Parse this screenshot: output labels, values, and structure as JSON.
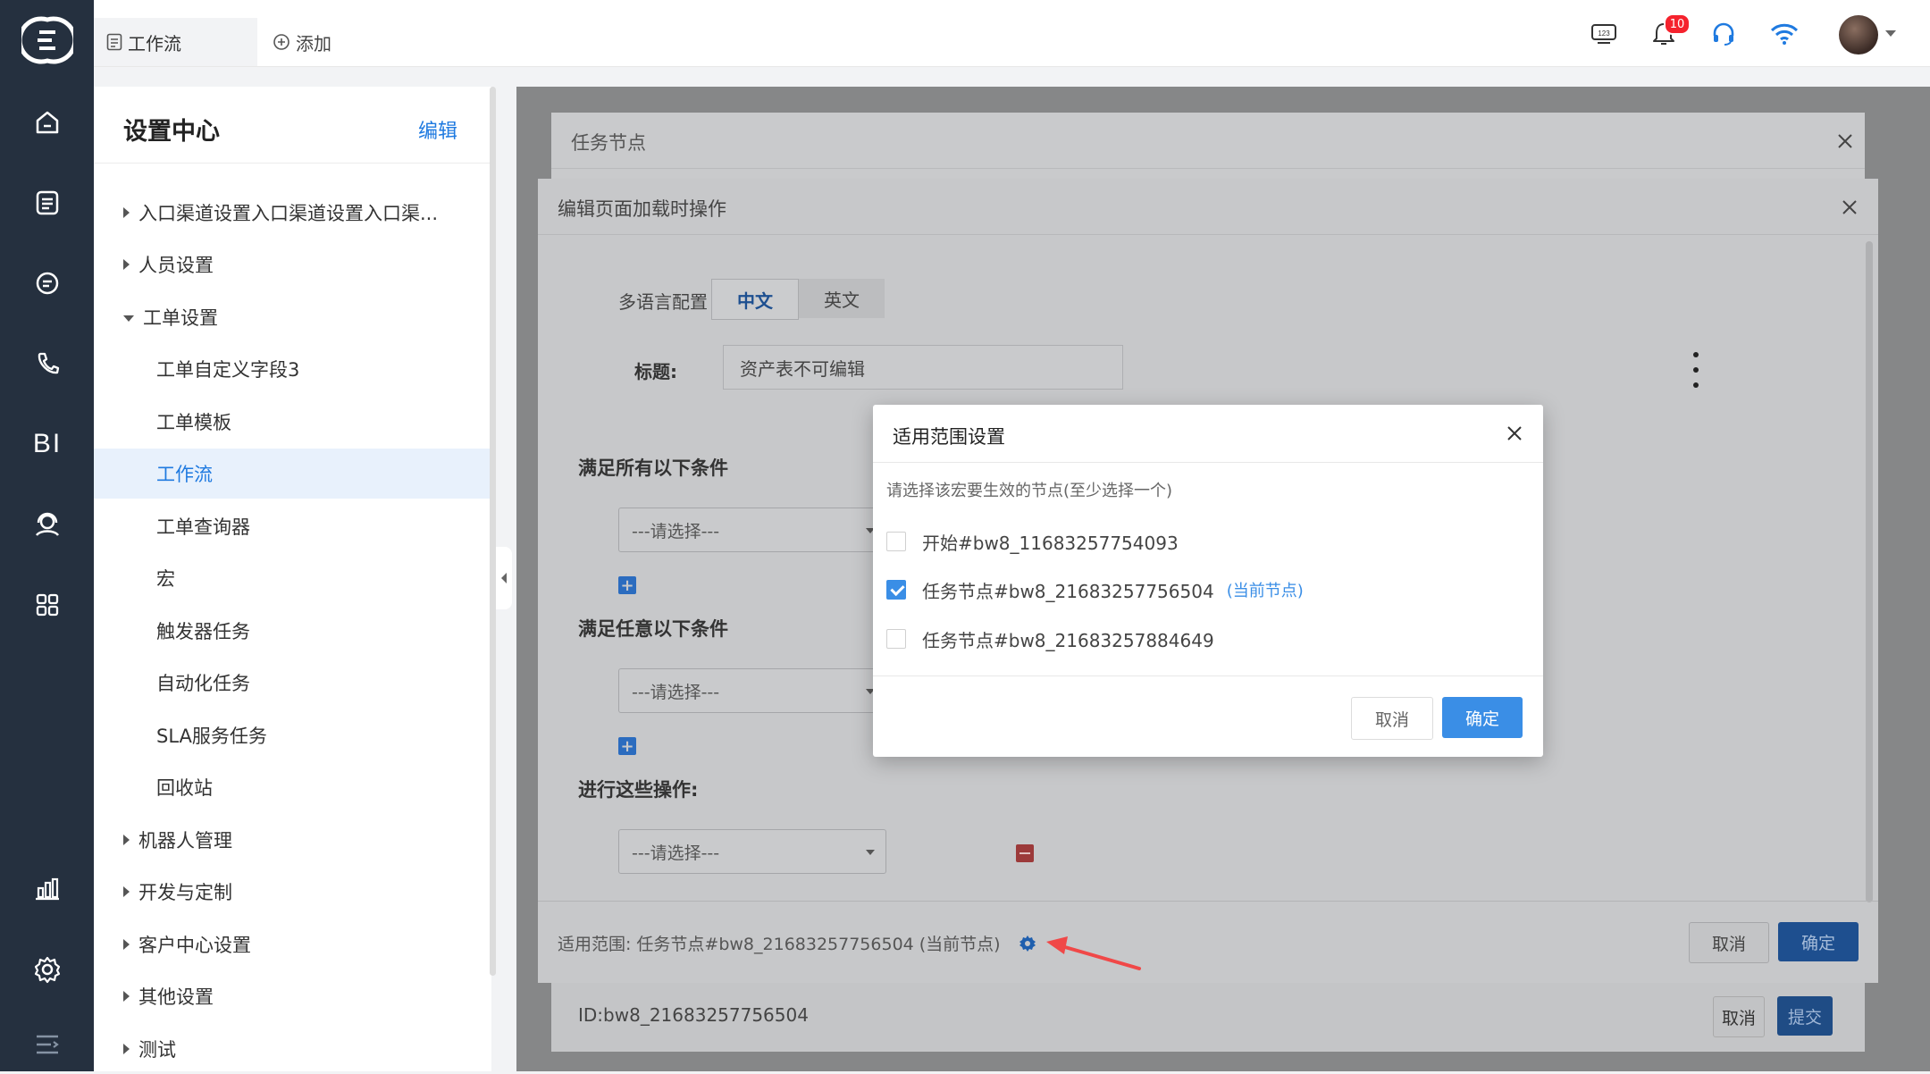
{
  "topbar": {
    "tab_label": "工作流",
    "add_label": "添加",
    "notification_count": "10"
  },
  "sidebar": {
    "title": "设置中心",
    "edit_label": "编辑",
    "items": [
      {
        "label": "入口渠道设置入口渠道设置入口渠..."
      },
      {
        "label": "人员设置"
      },
      {
        "label": "工单设置"
      },
      {
        "label": "工单自定义字段3"
      },
      {
        "label": "工单模板"
      },
      {
        "label": "工作流"
      },
      {
        "label": "工单查询器"
      },
      {
        "label": "宏"
      },
      {
        "label": "触发器任务"
      },
      {
        "label": "自动化任务"
      },
      {
        "label": "SLA服务任务"
      },
      {
        "label": "回收站"
      },
      {
        "label": "机器人管理"
      },
      {
        "label": "开发与定制"
      },
      {
        "label": "客户中心设置"
      },
      {
        "label": "其他设置"
      },
      {
        "label": "测试"
      }
    ]
  },
  "rail": {
    "bi_label": "BI"
  },
  "task_modal": {
    "title": "任务节点",
    "id_text": "ID:bw8_21683257756504",
    "cancel_label": "取消",
    "submit_label": "提交"
  },
  "edit_modal": {
    "title": "编辑页面加载时操作",
    "lang_label": "多语言配置",
    "lang_tabs": [
      "中文",
      "英文"
    ],
    "title_label": "标题:",
    "title_value": "资产表不可编辑",
    "section_all": "满足所有以下条件",
    "section_any": "满足任意以下条件",
    "section_actions": "进行这些操作:",
    "select_placeholder": "---请选择---",
    "scope_label": "适用范围:",
    "scope_value": "任务节点#bw8_21683257756504",
    "scope_current": "(当前节点)",
    "cancel_label": "取消",
    "ok_label": "确定"
  },
  "scope_dialog": {
    "title": "适用范围设置",
    "hint": "请选择该宏要生效的节点(至少选择一个)",
    "options": [
      {
        "label": "开始#bw8_11683257754093",
        "checked": false,
        "tag": ""
      },
      {
        "label": "任务节点#bw8_21683257756504",
        "checked": true,
        "tag": "(当前节点)"
      },
      {
        "label": "任务节点#bw8_21683257884649",
        "checked": false,
        "tag": ""
      }
    ],
    "cancel_label": "取消",
    "ok_label": "确定"
  },
  "colors": {
    "rail_bg": "#25303f",
    "accent": "#3a8ee6",
    "annotation_arrow": "#f04848"
  }
}
